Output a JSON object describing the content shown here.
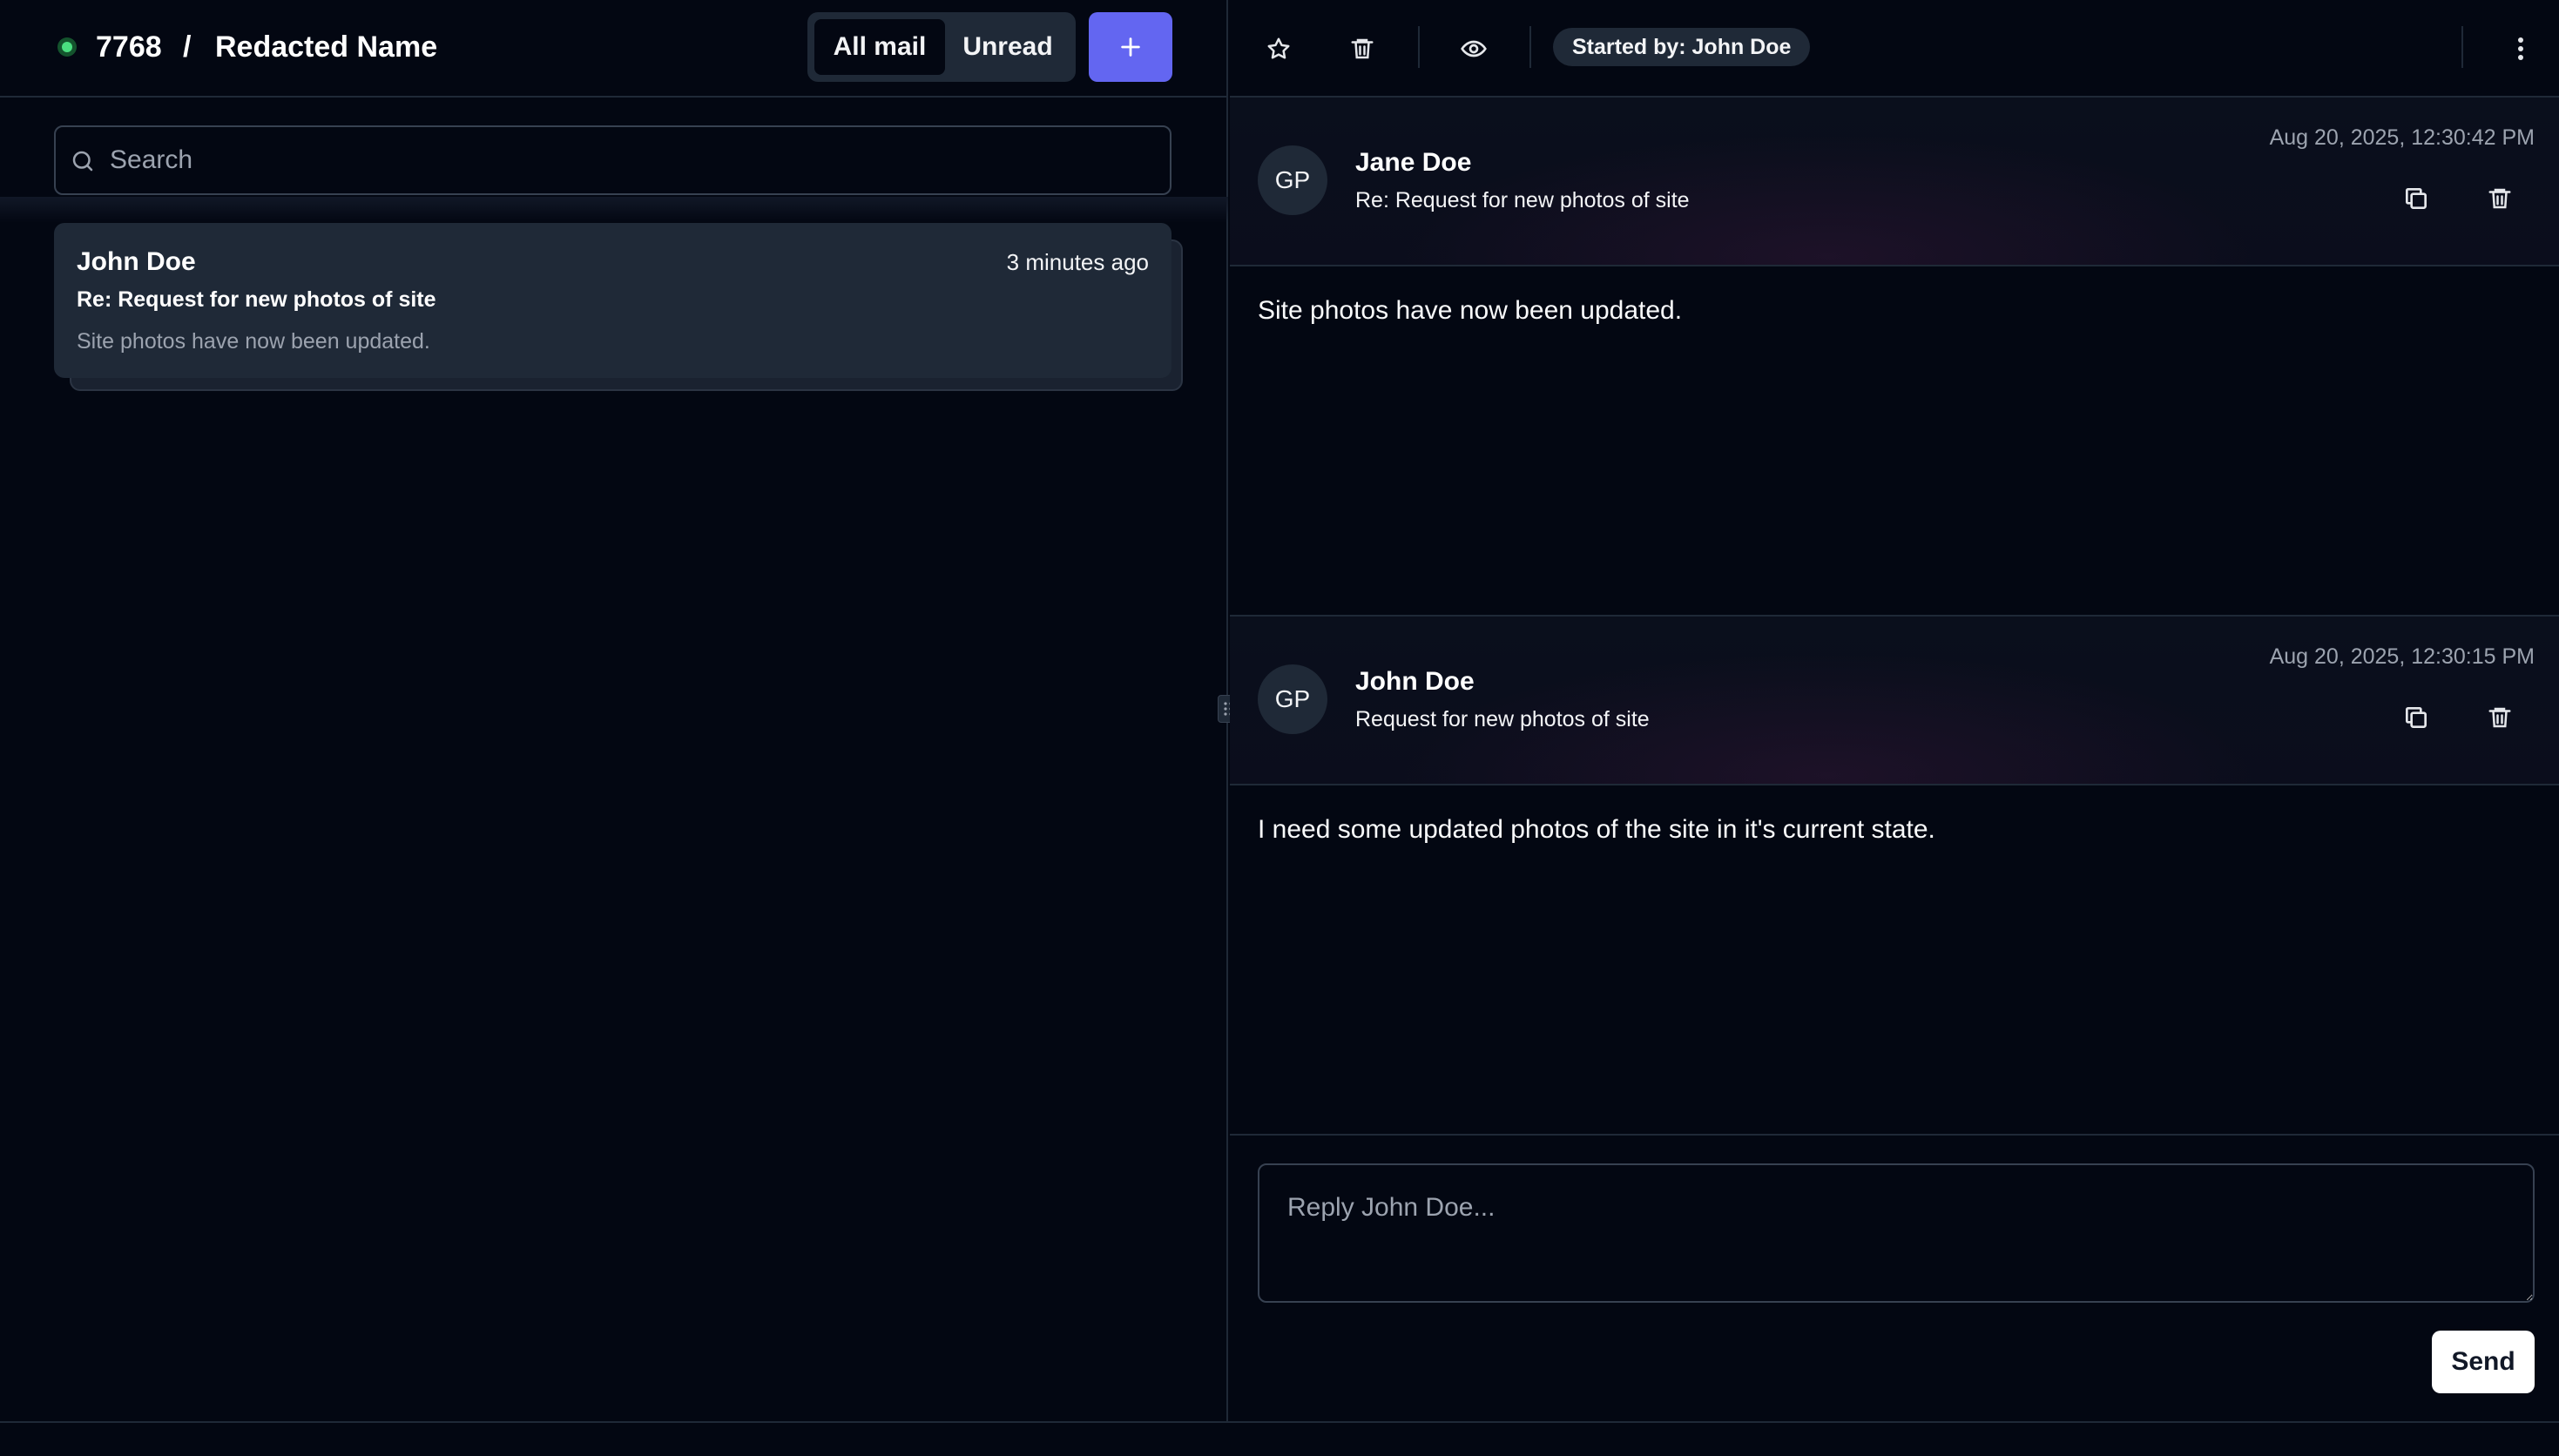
{
  "header": {
    "breadcrumb_id": "7768",
    "breadcrumb_separator": "/",
    "breadcrumb_name": "Redacted Name",
    "status_color": "#4ade80"
  },
  "filter_tabs": [
    {
      "label": "All mail",
      "active": true
    },
    {
      "label": "Unread",
      "active": false
    }
  ],
  "compose_button": {
    "icon": "plus-icon",
    "color": "#6366f1"
  },
  "search": {
    "placeholder": "Search",
    "value": ""
  },
  "mail_list": [
    {
      "sender": "John Doe",
      "time": "3 minutes ago",
      "subject": "Re: Request for new photos of site",
      "preview": "Site photos have now been updated."
    }
  ],
  "toolbar": {
    "icons": [
      "star-icon",
      "trash-icon",
      "eye-icon",
      "more-vertical-icon"
    ],
    "started_by": "Started by: John Doe"
  },
  "thread": [
    {
      "avatar_initials": "GP",
      "sender": "Jane Doe",
      "subject": "Re: Request for new photos of site",
      "date": "Aug 20, 2025, 12:30:42 PM",
      "body": "Site photos have now been updated."
    },
    {
      "avatar_initials": "GP",
      "sender": "John Doe",
      "subject": "Request for new photos of site",
      "date": "Aug 20, 2025, 12:30:15 PM",
      "body": "I need some updated photos of the site in it's current state."
    }
  ],
  "reply": {
    "placeholder": "Reply John Doe...",
    "send_label": "Send"
  }
}
